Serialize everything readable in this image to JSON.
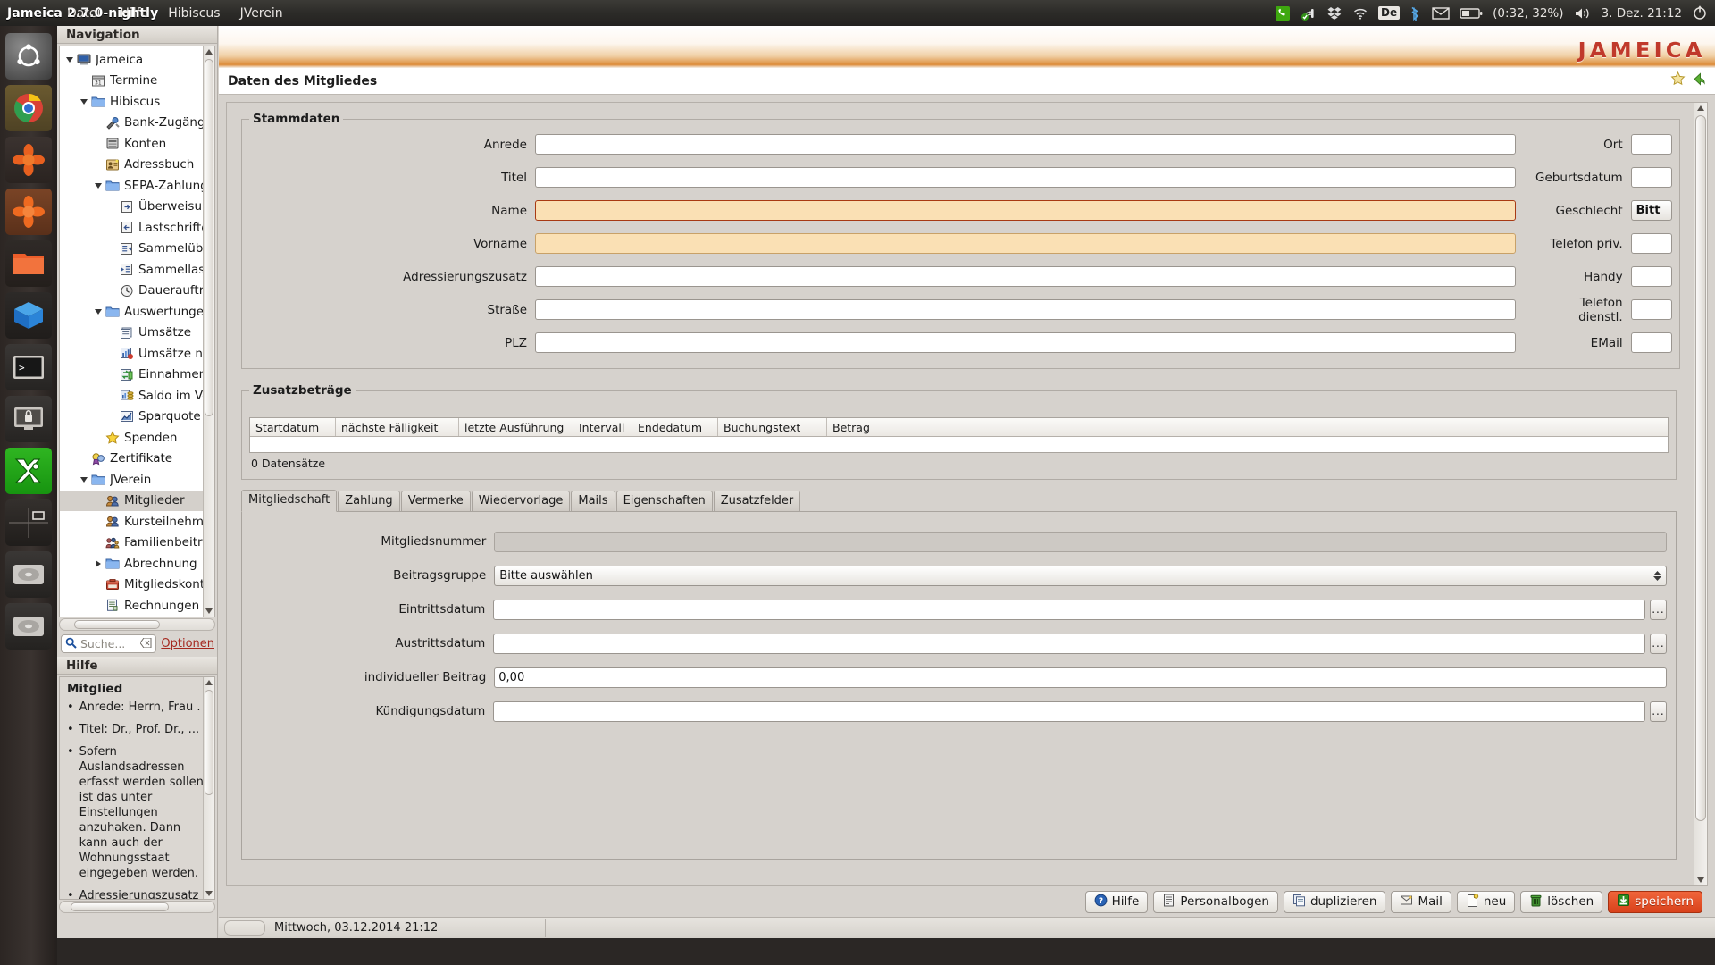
{
  "window": {
    "title": "Jameica 2.7.0-nightly",
    "menu": [
      "Datei",
      "Hilfe",
      "Hibiscus",
      "JVerein"
    ]
  },
  "tray": {
    "battery": "(0:32, 32%)",
    "keyboard": "De",
    "clock": "3. Dez. 21:12",
    "icons": [
      "phone-icon",
      "sync-icon",
      "dropbox-icon",
      "wifi-icon",
      "keyboard-layout-icon",
      "bluetooth-icon",
      "mail-icon",
      "battery-icon",
      "volume-icon",
      "power-icon"
    ]
  },
  "launcher": {
    "items": [
      {
        "name": "ubuntu-dash-icon"
      },
      {
        "name": "chrome-icon"
      },
      {
        "name": "jameica-icon"
      },
      {
        "name": "jameica-active-icon"
      },
      {
        "name": "files-icon"
      },
      {
        "name": "virtualbox-icon"
      },
      {
        "name": "terminal-icon"
      },
      {
        "name": "lockscreen-icon"
      },
      {
        "name": "x2go-icon"
      },
      {
        "name": "workspace-switcher-icon"
      },
      {
        "name": "drive-icon"
      },
      {
        "name": "drive2-icon"
      }
    ]
  },
  "navigation": {
    "header": "Navigation",
    "items": [
      {
        "label": "Jameica",
        "depth": 0,
        "twisty": "down",
        "icon": "computer-icon",
        "selected": false
      },
      {
        "label": "Termine",
        "depth": 1,
        "twisty": "",
        "icon": "calendar-icon",
        "selected": false
      },
      {
        "label": "Hibiscus",
        "depth": 1,
        "twisty": "down",
        "icon": "folder-icon",
        "selected": false
      },
      {
        "label": "Bank-Zugänge",
        "depth": 2,
        "twisty": "",
        "icon": "tools-icon",
        "selected": false
      },
      {
        "label": "Konten",
        "depth": 2,
        "twisty": "",
        "icon": "accounts-icon",
        "selected": false
      },
      {
        "label": "Adressbuch",
        "depth": 2,
        "twisty": "",
        "icon": "addressbook-icon",
        "selected": false
      },
      {
        "label": "SEPA-Zahlungsv",
        "depth": 2,
        "twisty": "down",
        "icon": "folder-icon",
        "selected": false
      },
      {
        "label": "Überweisunge",
        "depth": 3,
        "twisty": "",
        "icon": "transfer-icon",
        "selected": false
      },
      {
        "label": "Lastschriften",
        "depth": 3,
        "twisty": "",
        "icon": "debit-icon",
        "selected": false
      },
      {
        "label": "Sammelüberw",
        "depth": 3,
        "twisty": "",
        "icon": "batch-transfer-icon",
        "selected": false
      },
      {
        "label": "Sammellastsc",
        "depth": 3,
        "twisty": "",
        "icon": "batch-debit-icon",
        "selected": false
      },
      {
        "label": "Daueraufträg",
        "depth": 3,
        "twisty": "",
        "icon": "clock-icon",
        "selected": false
      },
      {
        "label": "Auswertungen",
        "depth": 2,
        "twisty": "down",
        "icon": "folder-icon",
        "selected": false
      },
      {
        "label": "Umsätze",
        "depth": 3,
        "twisty": "",
        "icon": "list-icon",
        "selected": false
      },
      {
        "label": "Umsätze nach",
        "depth": 3,
        "twisty": "",
        "icon": "chart-icon",
        "selected": false
      },
      {
        "label": "Einnahmen/Au",
        "depth": 3,
        "twisty": "",
        "icon": "inout-icon",
        "selected": false
      },
      {
        "label": "Saldo im Verla",
        "depth": 3,
        "twisty": "",
        "icon": "balance-icon",
        "selected": false
      },
      {
        "label": "Sparquote",
        "depth": 3,
        "twisty": "",
        "icon": "savings-icon",
        "selected": false
      },
      {
        "label": "Spenden",
        "depth": 2,
        "twisty": "",
        "icon": "star-icon",
        "selected": false
      },
      {
        "label": "Zertifikate",
        "depth": 1,
        "twisty": "",
        "icon": "certificate-icon",
        "selected": false
      },
      {
        "label": "JVerein",
        "depth": 1,
        "twisty": "down",
        "icon": "folder-icon",
        "selected": false
      },
      {
        "label": "Mitglieder",
        "depth": 2,
        "twisty": "",
        "icon": "members-icon",
        "selected": true
      },
      {
        "label": "Kursteilnehmer",
        "depth": 2,
        "twisty": "",
        "icon": "members-icon",
        "selected": false
      },
      {
        "label": "Familienbeitrag",
        "depth": 2,
        "twisty": "",
        "icon": "family-icon",
        "selected": false
      },
      {
        "label": "Abrechnung",
        "depth": 2,
        "twisty": "right",
        "icon": "folder-icon",
        "selected": false
      },
      {
        "label": "Mitgliedskonte",
        "depth": 2,
        "twisty": "",
        "icon": "account-box-icon",
        "selected": false
      },
      {
        "label": "Rechnungen",
        "depth": 2,
        "twisty": "",
        "icon": "invoice-icon",
        "selected": false
      }
    ]
  },
  "search": {
    "placeholder": "Suche...",
    "options_label": "Optionen"
  },
  "help": {
    "header": "Hilfe",
    "title": "Mitglied",
    "bullets": [
      "Anrede: Herrn, Frau .",
      "Titel: Dr., Prof. Dr., ...",
      "Sofern Auslandsadressen erfasst werden sollen, ist das unter Einstellungen anzuhaken. Dann kann auch der Wohnungsstaat eingegeben werden.",
      "Adressierungszusatz"
    ]
  },
  "banner": {
    "logo": "JAMEICA"
  },
  "page": {
    "title": "Daten des Mitgliedes",
    "actions": [
      "favorite-star-icon",
      "back-arrow-icon"
    ]
  },
  "stammdaten": {
    "legend": "Stammdaten",
    "left_fields": [
      {
        "label": "Anrede",
        "value": "",
        "state": "normal"
      },
      {
        "label": "Titel",
        "value": "",
        "state": "normal"
      },
      {
        "label": "Name",
        "value": "",
        "state": "required-focus"
      },
      {
        "label": "Vorname",
        "value": "",
        "state": "required"
      },
      {
        "label": "Adressierungszusatz",
        "value": "",
        "state": "normal"
      },
      {
        "label": "Straße",
        "value": "",
        "state": "normal"
      },
      {
        "label": "PLZ",
        "value": "",
        "state": "normal"
      }
    ],
    "right_fields": [
      {
        "label": "Ort",
        "value": "",
        "state": "normal",
        "type": "text"
      },
      {
        "label": "Geburtsdatum",
        "value": "",
        "state": "normal",
        "type": "text"
      },
      {
        "label": "Geschlecht",
        "value": "Bitt",
        "state": "normal",
        "type": "combo"
      },
      {
        "label": "Telefon priv.",
        "value": "",
        "state": "normal",
        "type": "text"
      },
      {
        "label": "Handy",
        "value": "",
        "state": "normal",
        "type": "text"
      },
      {
        "label": "Telefon dienstl.",
        "value": "",
        "state": "normal",
        "type": "text"
      },
      {
        "label": "EMail",
        "value": "",
        "state": "normal",
        "type": "text"
      }
    ]
  },
  "zusatzbetraege": {
    "legend": "Zusatzbeträge",
    "columns": [
      "Startdatum",
      "nächste Fälligkeit",
      "letzte Ausführung",
      "Intervall",
      "Endedatum",
      "Buchungstext",
      "Betrag"
    ],
    "rows": [],
    "record_count": "0 Datensätze"
  },
  "tabs": [
    {
      "label": "Mitgliedschaft",
      "active": true
    },
    {
      "label": "Zahlung",
      "active": false
    },
    {
      "label": "Vermerke",
      "active": false
    },
    {
      "label": "Wiedervorlage",
      "active": false
    },
    {
      "label": "Mails",
      "active": false
    },
    {
      "label": "Eigenschaften",
      "active": false
    },
    {
      "label": "Zusatzfelder",
      "active": false
    }
  ],
  "mitgliedschaft": {
    "fields": [
      {
        "label": "Mitgliedsnummer",
        "value": "",
        "type": "text",
        "state": "disabled",
        "button": false
      },
      {
        "label": "Beitragsgruppe",
        "value": "Bitte auswählen",
        "type": "combo",
        "state": "normal",
        "button": false
      },
      {
        "label": "Eintrittsdatum",
        "value": "",
        "type": "text",
        "state": "normal",
        "button": true
      },
      {
        "label": "Austrittsdatum",
        "value": "",
        "type": "text",
        "state": "normal",
        "button": true
      },
      {
        "label": "individueller Beitrag",
        "value": "0,00",
        "type": "text",
        "state": "normal",
        "button": false
      },
      {
        "label": "Kündigungsdatum",
        "value": "",
        "type": "text",
        "state": "normal",
        "button": true
      }
    ],
    "dots_label": "..."
  },
  "buttons": [
    {
      "label": "Hilfe",
      "icon": "help-icon",
      "primary": false
    },
    {
      "label": "Personalbogen",
      "icon": "document-icon",
      "primary": false
    },
    {
      "label": "duplizieren",
      "icon": "copy-icon",
      "primary": false
    },
    {
      "label": "Mail",
      "icon": "mail-icon",
      "primary": false
    },
    {
      "label": "neu",
      "icon": "new-icon",
      "primary": false
    },
    {
      "label": "löschen",
      "icon": "trash-icon",
      "primary": false
    },
    {
      "label": "speichern",
      "icon": "save-icon",
      "primary": true
    }
  ],
  "statusbar": {
    "text": "Mittwoch, 03.12.2014 21:12"
  },
  "colors": {
    "accent_orange": "#d9421b",
    "required_bg": "#fae0b4",
    "focus_border": "#a83a13",
    "link_red": "#a5281f",
    "panel_bg": "#d6d2cd"
  }
}
